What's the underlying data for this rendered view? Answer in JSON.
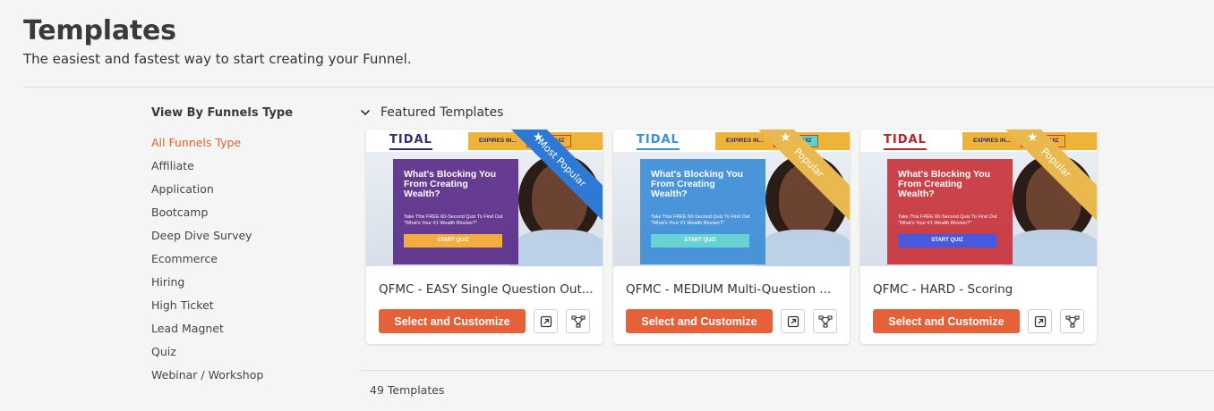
{
  "header": {
    "title": "Templates",
    "subtitle": "The easiest and fastest way to start creating your Funnel."
  },
  "sidebar": {
    "heading": "View By Funnels Type",
    "items": [
      {
        "label": "All Funnels Type",
        "active": true
      },
      {
        "label": "Affiliate"
      },
      {
        "label": "Application"
      },
      {
        "label": "Bootcamp"
      },
      {
        "label": "Deep Dive Survey"
      },
      {
        "label": "Ecommerce"
      },
      {
        "label": "Hiring"
      },
      {
        "label": "High Ticket"
      },
      {
        "label": "Lead Magnet"
      },
      {
        "label": "Quiz"
      },
      {
        "label": "Webinar / Workshop"
      }
    ]
  },
  "main": {
    "section_title": "Featured Templates",
    "cards": [
      {
        "title": "QFMC - EASY Single Question Out...",
        "ribbon": "Most Popular",
        "ribbon_color": "#2f79d6",
        "panel_color": "#5b2d8a",
        "panel_button_color": "#f3a930",
        "logo_color": "#3b2b6e",
        "thumb": {
          "logo": "TIDAL",
          "expires": "EXPIRES IN...",
          "start": "START QUIZ",
          "headline": "What's Blocking You From Creating Wealth?",
          "desc": "Take This FREE 60-Second Quiz To Find Out \"What's Your #1 Wealth Blocker?\"",
          "button": "START QUIZ"
        },
        "select_label": "Select and Customize"
      },
      {
        "title": "QFMC - MEDIUM Multi-Question ...",
        "ribbon": "Popular",
        "ribbon_color": "#e9b94f",
        "panel_color": "#3d8ed8",
        "panel_button_color": "#5fd0d0",
        "logo_color": "#3d8ed8",
        "thumb": {
          "logo": "TIDAL",
          "expires": "EXPIRES IN...",
          "start": "START QUIZ",
          "headline": "What's Blocking You From Creating Wealth?",
          "desc": "Take This FREE 60-Second Quiz To Find Out \"What's Your #1 Wealth Blocker?\"",
          "button": "START QUIZ"
        },
        "select_label": "Select and Customize"
      },
      {
        "title": "QFMC - HARD - Scoring",
        "ribbon": "Popular",
        "ribbon_color": "#e9b94f",
        "panel_color": "#c8333c",
        "panel_button_color": "#3a4fe0",
        "logo_color": "#b0262e",
        "thumb": {
          "logo": "TIDAL",
          "expires": "EXPIRES IN...",
          "start": "START QUIZ",
          "headline": "What's Blocking You From Creating Wealth?",
          "desc": "Take This FREE 60-Second Quiz To Find Out \"What's Your #1 Wealth Blocker?\"",
          "button": "START QUIZ"
        },
        "select_label": "Select and Customize"
      }
    ],
    "count_label": "49 Templates"
  },
  "colors": {
    "accent": "#e4613a",
    "active_link": "#e8602c"
  }
}
